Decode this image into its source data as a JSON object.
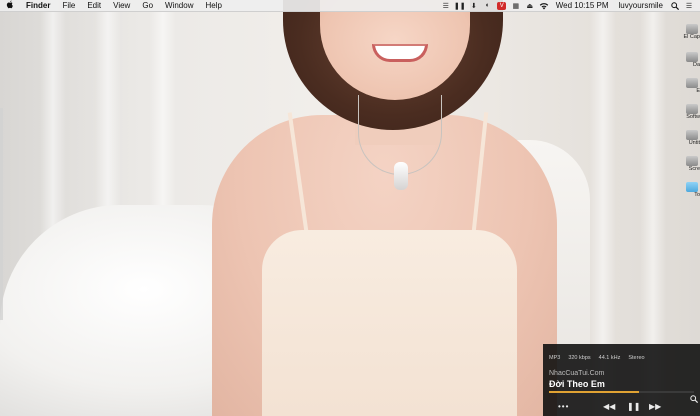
{
  "menubar": {
    "apple_icon": "apple-icon",
    "app_name": "Finder",
    "menus": [
      "File",
      "Edit",
      "View",
      "Go",
      "Window",
      "Help"
    ],
    "status_icons": [
      "list-icon",
      "pause-icon",
      "download-icon",
      "shield-icon",
      "vivaldi-icon",
      "grid-icon",
      "eject-icon",
      "wifi-icon"
    ],
    "badge_icon_text": "V",
    "clock": "Wed 10:15 PM",
    "user": "luvyoursmile",
    "search_icon": "search-icon",
    "notification_icon": "list-icon"
  },
  "desktop_icons": [
    {
      "label": "El Cap"
    },
    {
      "label": "Da"
    },
    {
      "label": "E"
    },
    {
      "label": "Softw"
    },
    {
      "label": "Untit"
    },
    {
      "label": "Scre"
    },
    {
      "label": "To"
    }
  ],
  "player": {
    "format": "MP3",
    "bitrate": "320 kbps",
    "sample_rate": "44.1 kHz",
    "channels": "Stereo",
    "site": "NhacCuaTui.Com",
    "song": "Đời Theo Em",
    "progress": 0.62,
    "accent_color": "#e0a233",
    "more_label": "•••",
    "prev_label": "◀◀",
    "pause_label": "❚❚",
    "next_label": "▶▶"
  }
}
